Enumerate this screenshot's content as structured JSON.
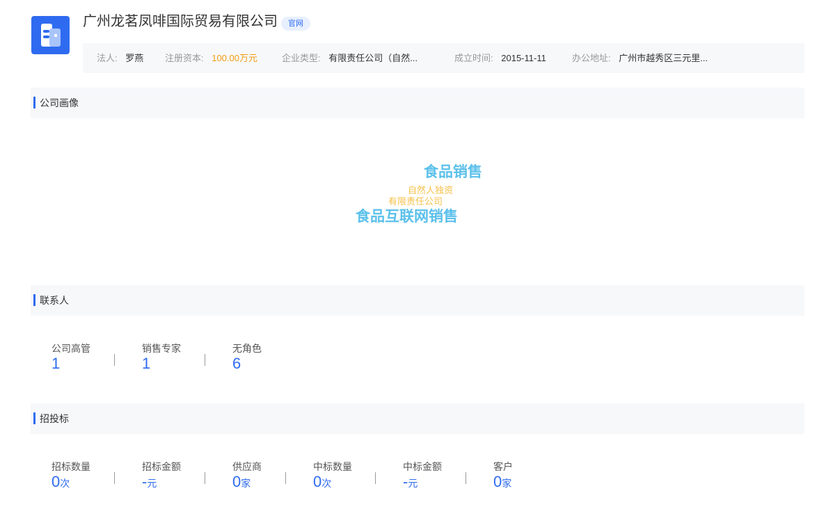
{
  "company": {
    "name": "广州龙茗凤啡国际贸易有限公司",
    "badge": "官网",
    "logo_color": "#2f6bf0"
  },
  "info": {
    "legal_person_label": "法人:",
    "legal_person": "罗燕",
    "capital_label": "注册资本:",
    "capital": "100.00万元",
    "type_label": "企业类型:",
    "type": "有限责任公司（自然...",
    "founded_label": "成立时间:",
    "founded": "2015-11-11",
    "address_label": "办公地址:",
    "address": "广州市越秀区三元里..."
  },
  "portrait": {
    "title": "公司画像",
    "words": [
      "食品销售",
      "自然人独资",
      "有限责任公司",
      "食品互联网销售"
    ],
    "colors": {
      "primary": "#5bc0eb",
      "secondary": "#f5c04a"
    }
  },
  "contacts": {
    "title": "联系人",
    "stats": [
      {
        "label": "公司高管",
        "value": "1"
      },
      {
        "label": "销售专家",
        "value": "1"
      },
      {
        "label": "无角色",
        "value": "6"
      }
    ]
  },
  "bidding": {
    "title": "招投标",
    "stats": [
      {
        "label": "招标数量",
        "value": "0",
        "unit": "次"
      },
      {
        "label": "招标金额",
        "value": "-",
        "unit": "元"
      },
      {
        "label": "供应商",
        "value": "0",
        "unit": "家"
      },
      {
        "label": "中标数量",
        "value": "0",
        "unit": "次"
      },
      {
        "label": "中标金额",
        "value": "-",
        "unit": "元"
      },
      {
        "label": "客户",
        "value": "0",
        "unit": "家"
      }
    ]
  }
}
